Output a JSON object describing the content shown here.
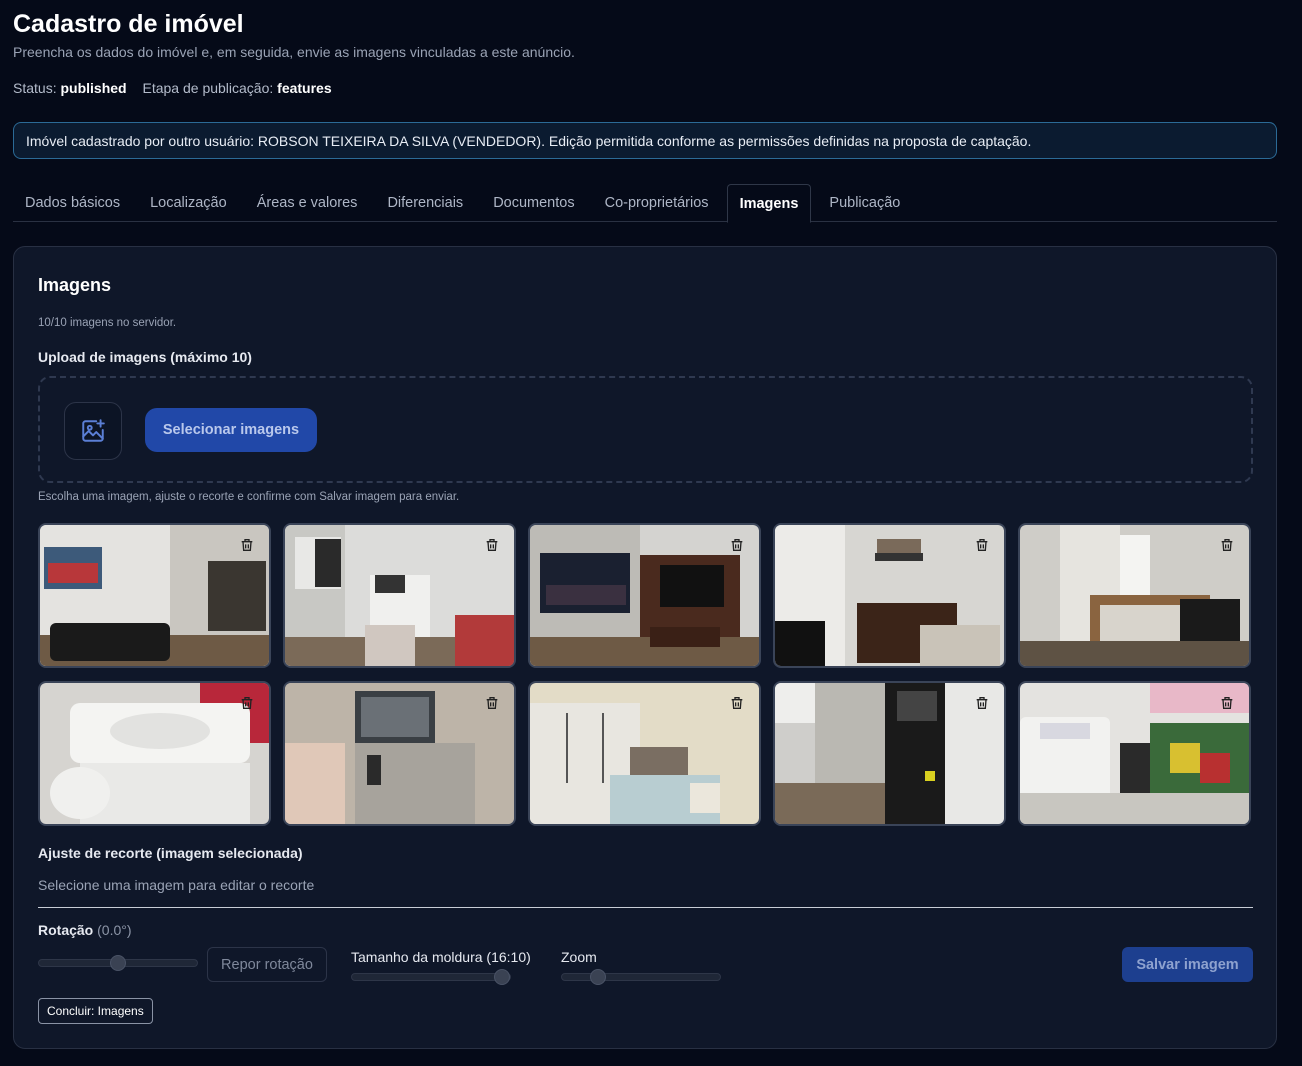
{
  "header": {
    "title": "Cadastro de imóvel",
    "subtitle": "Preencha os dados do imóvel e, em seguida, envie as imagens vinculadas a este anúncio.",
    "status_label": "Status:",
    "status_value": "published",
    "stage_label": "Etapa de publicação:",
    "stage_value": "features"
  },
  "notice": "Imóvel cadastrado por outro usuário: ROBSON TEIXEIRA DA SILVA (VENDEDOR). Edição permitida conforme as permissões definidas na proposta de captação.",
  "tabs": [
    {
      "label": "Dados básicos"
    },
    {
      "label": "Localização"
    },
    {
      "label": "Áreas e valores"
    },
    {
      "label": "Diferenciais"
    },
    {
      "label": "Documentos"
    },
    {
      "label": "Co-proprietários"
    },
    {
      "label": "Imagens"
    },
    {
      "label": "Publicação"
    }
  ],
  "active_tab": "Imagens",
  "images": {
    "title": "Imagens",
    "server_count": "10/10 imagens no servidor.",
    "upload_label": "Upload de imagens (máximo 10)",
    "add_icon": "image-plus-icon",
    "select_button": "Selecionar imagens",
    "help_text": "Escolha uma imagem, ajuste o recorte e confirme com Salvar imagem para enviar.",
    "thumbnails": [
      {
        "scene": "living-room",
        "delete_icon": "trash-icon"
      },
      {
        "scene": "kitchen",
        "delete_icon": "trash-icon"
      },
      {
        "scene": "living-room-tv",
        "delete_icon": "trash-icon"
      },
      {
        "scene": "office-desk",
        "delete_icon": "trash-icon"
      },
      {
        "scene": "bedroom-single",
        "delete_icon": "trash-icon"
      },
      {
        "scene": "bathroom-sink",
        "delete_icon": "trash-icon"
      },
      {
        "scene": "shower",
        "delete_icon": "trash-icon"
      },
      {
        "scene": "bedroom-double",
        "delete_icon": "trash-icon"
      },
      {
        "scene": "kitchen-cabinets",
        "delete_icon": "trash-icon"
      },
      {
        "scene": "laundry",
        "delete_icon": "trash-icon"
      }
    ]
  },
  "crop": {
    "title": "Ajuste de recorte (imagem selecionada)",
    "hint": "Selecione uma imagem para editar o recorte",
    "rotation_label": "Rotação",
    "rotation_value": "(0.0°)",
    "rotation_level": 0.5,
    "reset_button": "Repor rotação",
    "frame_label": "Tamanho da moldura (16:10)",
    "frame_level": 1.0,
    "zoom_label": "Zoom",
    "zoom_level": 0.2,
    "save_button": "Salvar imagem",
    "done_button": "Concluir: Imagens"
  }
}
